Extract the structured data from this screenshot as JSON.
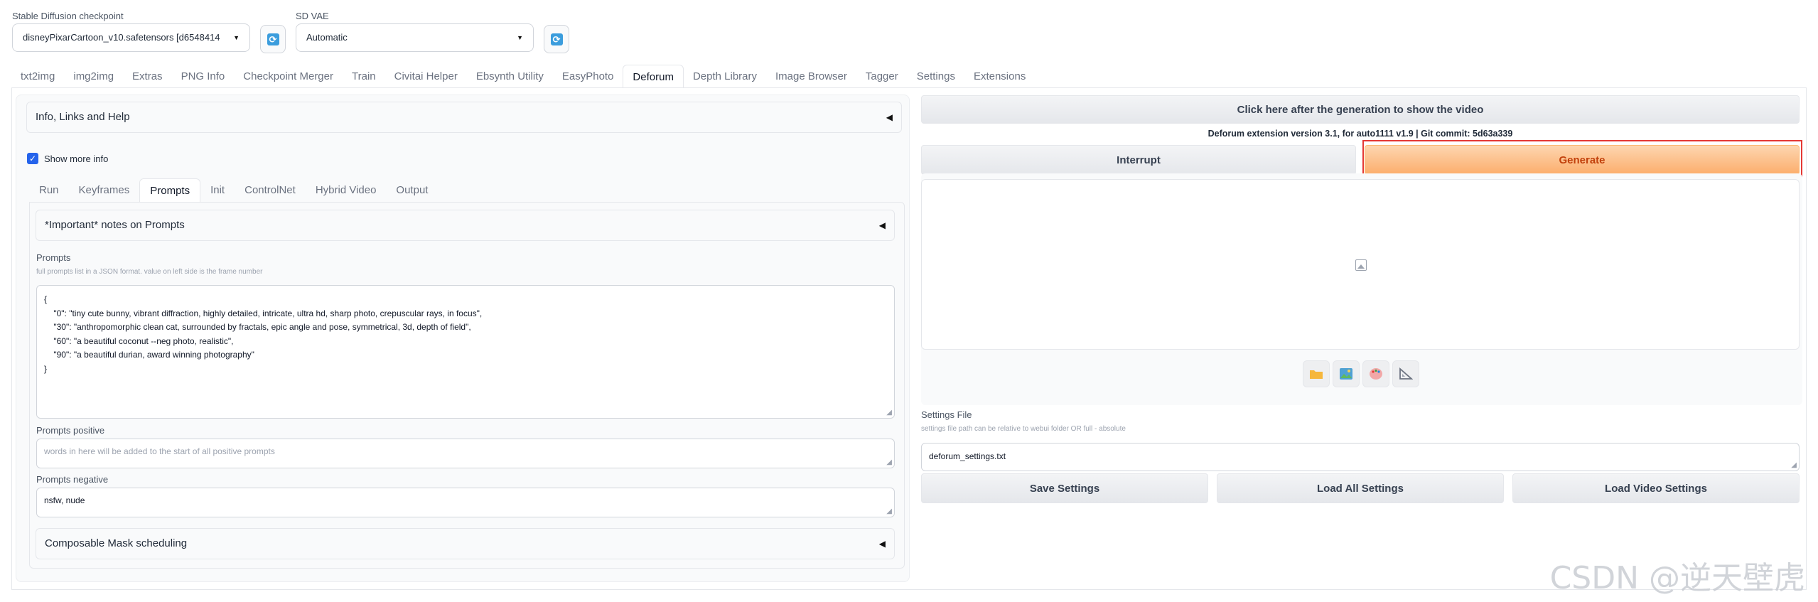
{
  "top": {
    "checkpoint_label": "Stable Diffusion checkpoint",
    "checkpoint_value": "disneyPixarCartoon_v10.safetensors [d6548414",
    "vae_label": "SD VAE",
    "vae_value": "Automatic"
  },
  "tabs": [
    "txt2img",
    "img2img",
    "Extras",
    "PNG Info",
    "Checkpoint Merger",
    "Train",
    "Civitai Helper",
    "Ebsynth Utility",
    "EasyPhoto",
    "Deforum",
    "Depth Library",
    "Image Browser",
    "Tagger",
    "Settings",
    "Extensions"
  ],
  "active_tab": "Deforum",
  "left": {
    "info_accordion": "Info, Links and Help",
    "show_more_info": "Show more info",
    "subtabs": [
      "Run",
      "Keyframes",
      "Prompts",
      "Init",
      "ControlNet",
      "Hybrid Video",
      "Output"
    ],
    "active_subtab": "Prompts",
    "notes_accordion": "*Important* notes on Prompts",
    "prompts_label": "Prompts",
    "prompts_info": "full prompts list in a JSON format.  value on left side is the frame number",
    "prompts_lines": [
      "{",
      "    \"0\": \"tiny cute bunny, vibrant diffraction, highly detailed, intricate, ultra hd, sharp photo, crepuscular rays, in focus\",",
      "    \"30\": \"anthropomorphic clean cat, surrounded by fractals, epic angle and pose, symmetrical, 3d, depth of field\",",
      "    \"60\": \"a beautiful coconut --neg photo, realistic\",",
      "    \"90\": \"a beautiful durian, award winning photography\"",
      "}"
    ],
    "positive_label": "Prompts positive",
    "positive_placeholder": "words in here will be added to the start of all positive prompts",
    "negative_label": "Prompts negative",
    "negative_value": "nsfw, nude",
    "mask_accordion": "Composable Mask scheduling"
  },
  "right": {
    "show_video_button": "Click here after the generation to show the video",
    "version_text": "Deforum extension version 3.1, for auto1111 v1.9 | Git commit: 5d63a339",
    "interrupt_button": "Interrupt",
    "generate_button": "Generate",
    "tool_icons": [
      "folder-icon",
      "image-icon",
      "palette-icon",
      "ruler-icon"
    ],
    "settings_file_label": "Settings File",
    "settings_file_info": "settings file path can be relative to webui folder OR full - absolute",
    "settings_file_value": "deforum_settings.txt",
    "save_settings": "Save Settings",
    "load_all_settings": "Load All Settings",
    "load_video_settings": "Load Video Settings"
  },
  "watermark": "CSDN @逆天壁虎",
  "colors": {
    "accent_orange": "#fcae6c",
    "highlight_red": "#e53935",
    "checkbox_blue": "#2563eb"
  }
}
